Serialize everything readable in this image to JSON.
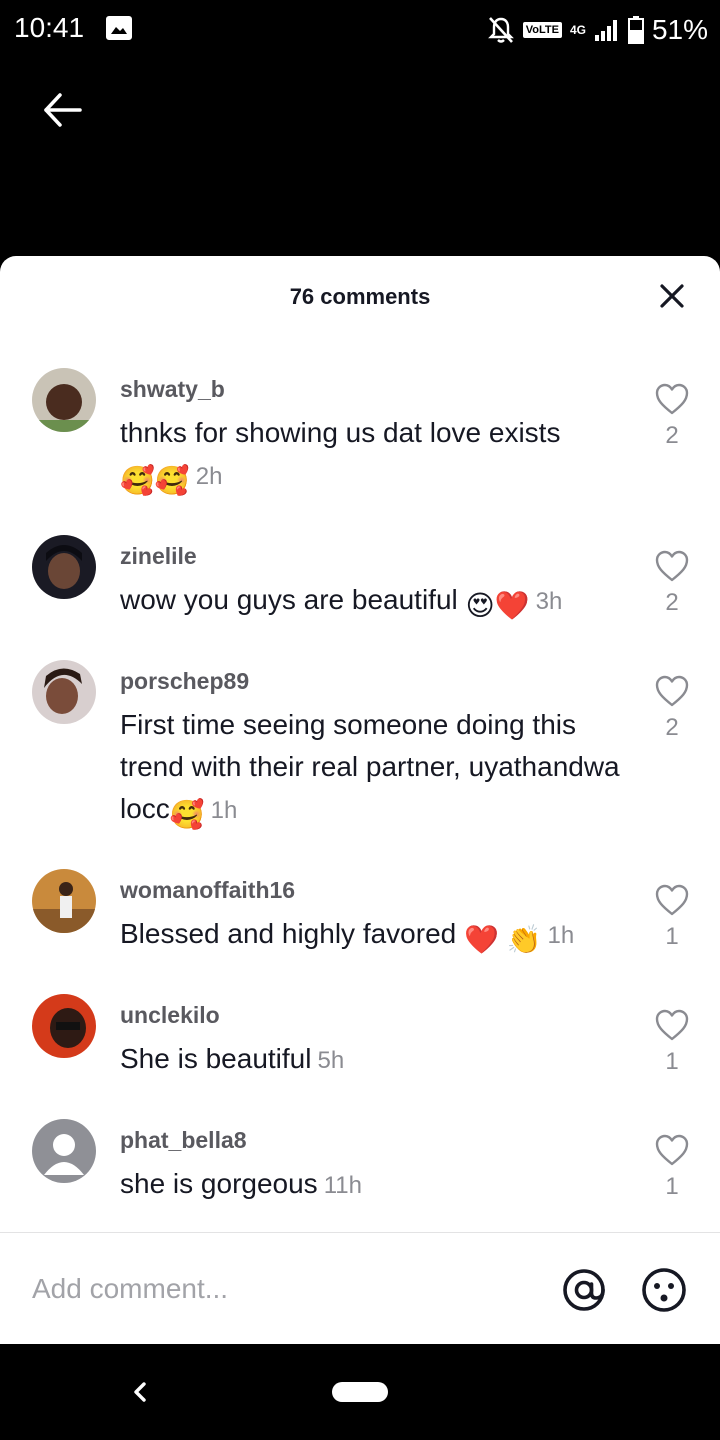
{
  "status_bar": {
    "time": "10:41",
    "volte": "VoLTE",
    "network": "4G",
    "battery": "51%"
  },
  "sheet": {
    "title": "76 comments"
  },
  "comments": [
    {
      "username": "shwaty_b",
      "text": "thnks for showing us dat love exists",
      "emoji": "🥰🥰",
      "time": "2h",
      "likes": "2"
    },
    {
      "username": "zinelile",
      "text": "wow you guys are beautiful ",
      "emoji": "😍❤️",
      "time": "3h",
      "likes": "2"
    },
    {
      "username": "porschep89",
      "text": "First time seeing someone doing this trend with their real partner, uyathandwa locc",
      "emoji": "🥰",
      "time": "1h",
      "likes": "2"
    },
    {
      "username": "womanoffaith16",
      "text": "Blessed and highly favored ",
      "emoji": "❤️ 👏",
      "time": "1h",
      "likes": "1"
    },
    {
      "username": "unclekilo",
      "text": "She is beautiful",
      "emoji": "",
      "time": "5h",
      "likes": "1"
    },
    {
      "username": "phat_bella8",
      "text": "she is gorgeous",
      "emoji": "",
      "time": "11h",
      "likes": "1"
    }
  ],
  "composer": {
    "placeholder": "Add comment..."
  },
  "colors": {
    "primary_text": "#161823",
    "secondary_text": "#8a8b91",
    "username": "#59595f"
  }
}
